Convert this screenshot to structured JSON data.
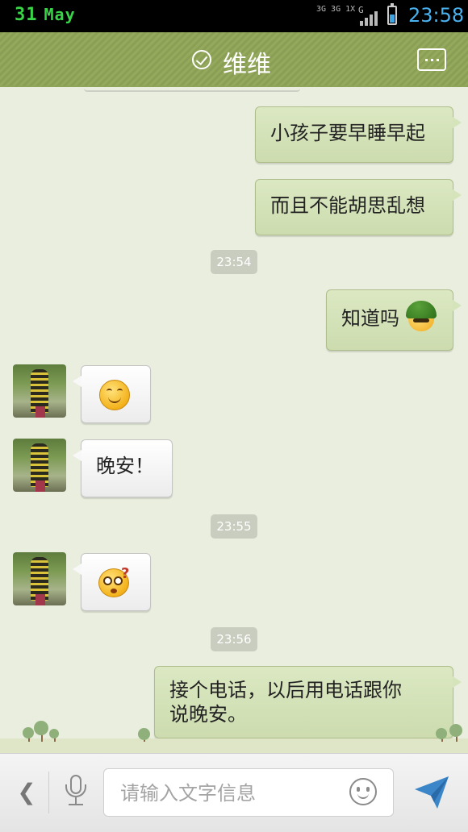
{
  "status_bar": {
    "date_day": "31",
    "date_month": "May",
    "network_label": "3G 3G 1X",
    "signal_label": "G",
    "time": "23:58",
    "battery_level": 0.55
  },
  "header": {
    "title": "维维",
    "icons": [
      "check-circle-icon",
      "more-options-icon"
    ]
  },
  "messages": [
    {
      "side": "out",
      "text": "小孩子要早睡早起"
    },
    {
      "side": "out",
      "text": "而且不能胡思乱想"
    },
    {
      "type": "time",
      "text": "23:54"
    },
    {
      "side": "out",
      "text": "知道吗",
      "emoji": "helmet-emoji"
    },
    {
      "side": "in",
      "emoji": "smile-emoji"
    },
    {
      "side": "in",
      "text": "晚安！"
    },
    {
      "type": "time",
      "text": "23:55"
    },
    {
      "side": "in",
      "emoji": "confused-emoji"
    },
    {
      "type": "time",
      "text": "23:56"
    },
    {
      "side": "out",
      "text": "接个电话，以后用电话跟你说晚安。"
    }
  ],
  "chat": {
    "msg1": "小孩子要早睡早起",
    "msg2": "而且不能胡思乱想",
    "time1": "23:54",
    "msg3": "知道吗",
    "msg5": "晚安！",
    "time2": "23:55",
    "time3": "23:56",
    "msg7_line1": "接个电话，以后用电话跟你",
    "msg7_line2": "说晚安。"
  },
  "input_bar": {
    "back_glyph": "❮",
    "placeholder": "请输入文字信息",
    "value": "",
    "icons": [
      "back-icon",
      "microphone-icon",
      "emoji-icon",
      "send-icon"
    ]
  },
  "colors": {
    "header": "#8fa459",
    "outgoing_bubble": "#d4e2b8",
    "incoming_bubble": "#f5f5f5",
    "time_accent": "#49b2ef",
    "date_accent": "#39d447"
  }
}
